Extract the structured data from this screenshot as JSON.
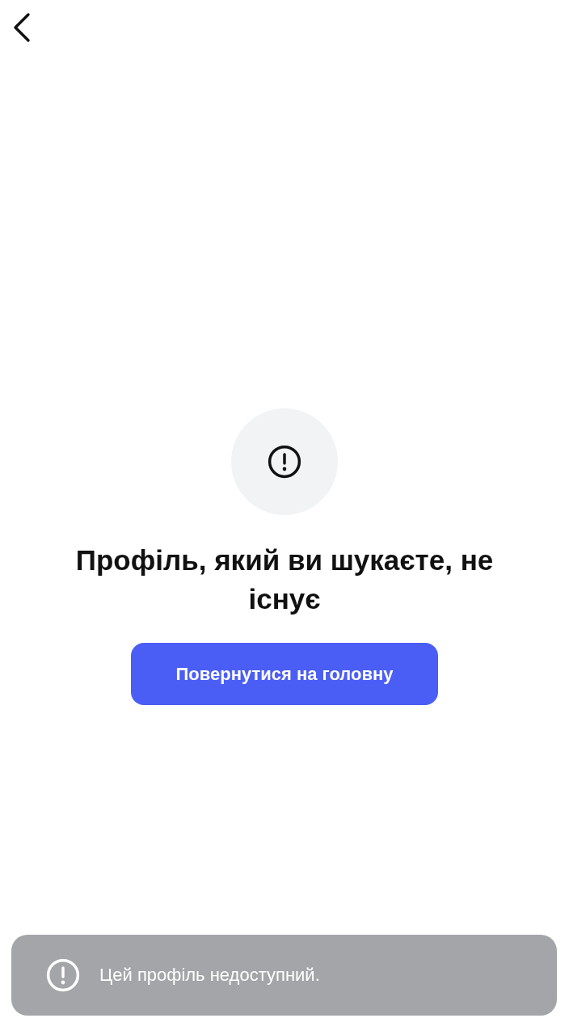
{
  "empty_state": {
    "title": "Профіль, який ви шукаєте, не існує",
    "button": "Повернутися на головну"
  },
  "toast": {
    "message": "Цей профіль недоступний."
  }
}
